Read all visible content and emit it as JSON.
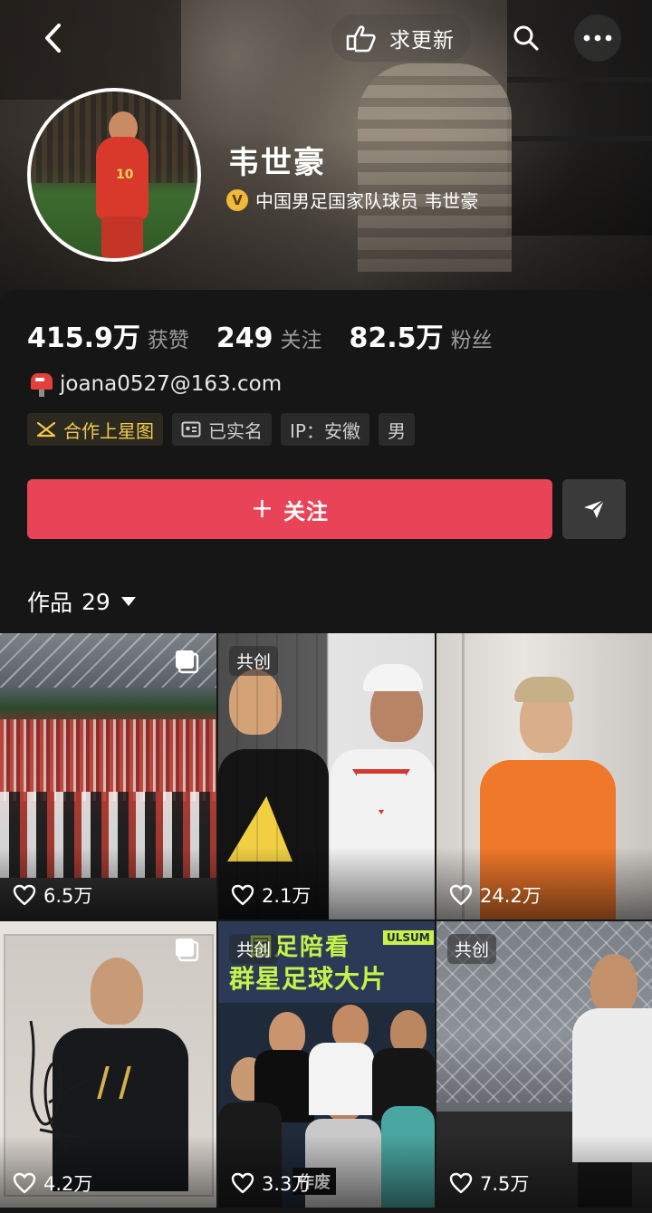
{
  "topbar": {
    "update_label": "求更新"
  },
  "profile": {
    "name": "韦世豪",
    "verify_text": "中国男足国家队球员 韦世豪",
    "avatar_number": "10"
  },
  "stats": [
    {
      "value": "415.9万",
      "label": "获赞"
    },
    {
      "value": "249",
      "label": "关注"
    },
    {
      "value": "82.5万",
      "label": "粉丝"
    }
  ],
  "contact": {
    "email": "joana0527@163.com"
  },
  "tags": {
    "star": "合作上星图",
    "realname": "已实名",
    "ip": "IP：安徽",
    "gender": "男"
  },
  "actions": {
    "follow_label": "关注"
  },
  "works": {
    "label": "作品",
    "count": "29"
  },
  "grid": [
    {
      "likes": "6.5万",
      "cocreate": ""
    },
    {
      "likes": "2.1万",
      "cocreate": "共创"
    },
    {
      "likes": "24.2万",
      "cocreate": ""
    },
    {
      "likes": "4.2万",
      "cocreate": ""
    },
    {
      "likes": "3.3万",
      "cocreate": "共创",
      "poster_line1": "国足陪看",
      "poster_line2": "群星足球大片",
      "brand": "ULSUM",
      "sub": "作废"
    },
    {
      "likes": "7.5万",
      "cocreate": "共创"
    }
  ],
  "colors": {
    "follow": "#e94357",
    "verify_badge": "#f0b93a",
    "star_tag": "#f2c94c"
  }
}
